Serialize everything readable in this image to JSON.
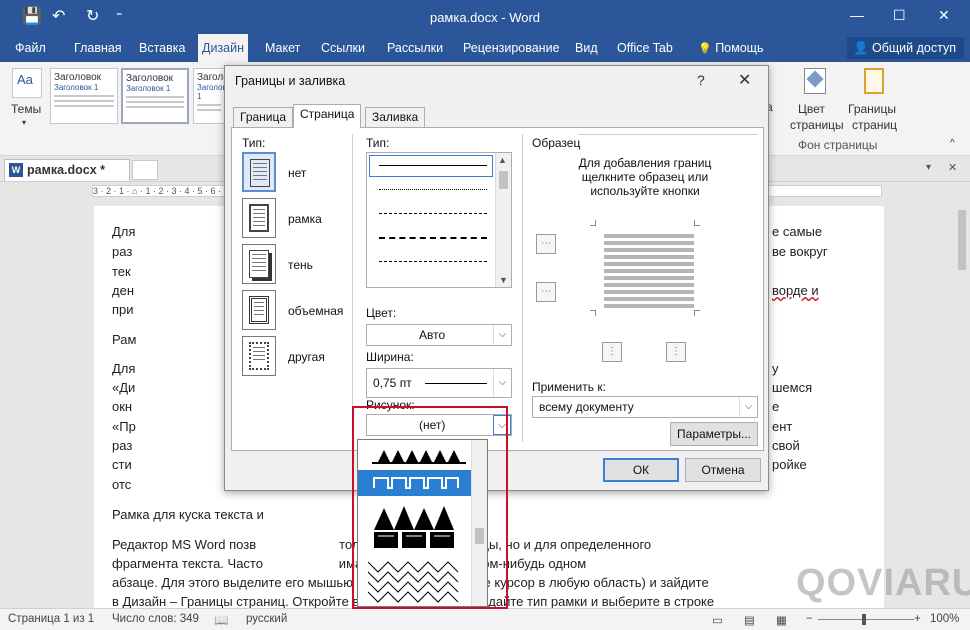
{
  "window": {
    "title": "рамка.docx - Word",
    "qat": [
      "💾",
      "↶",
      "↻",
      "⁼"
    ],
    "controls": [
      "—",
      "☐",
      "✕"
    ]
  },
  "ribbon_tabs": [
    {
      "label": "Файл"
    },
    {
      "label": "Главная"
    },
    {
      "label": "Вставка"
    },
    {
      "label": "Дизайн"
    },
    {
      "label": "Макет"
    },
    {
      "label": "Ссылки"
    },
    {
      "label": "Рассылки"
    },
    {
      "label": "Рецензирование"
    },
    {
      "label": "Вид"
    },
    {
      "label": "Office Tab"
    },
    {
      "label": "Помощь"
    }
  ],
  "share_label": "Общий доступ",
  "ribbon": {
    "themes_label": "Темы",
    "style_gallery": [
      {
        "title": "Заголовок",
        "subtitle": "Заголовок 1"
      },
      {
        "title": "Заголовок",
        "subtitle": "Заголовок 1"
      },
      {
        "title": "Заголовок",
        "subtitle": "Заголовок 1"
      }
    ],
    "page_color_label": [
      "Цвет",
      "страницы"
    ],
    "page_borders_label": [
      "Границы",
      "страниц"
    ],
    "background_group_label": "Фон страницы"
  },
  "doc_tab": {
    "name": "рамка.docx *"
  },
  "ruler_text": "3 · 2 · 1 · ⌂ · 1 · 2 · 3 · 4 · 5 · 6 · 7 · 8 · 9 · 10 · 11 · 12 · 13 · 14 · 15 · 16 · 17 · ",
  "document": {
    "left_stubs": [
      "Для",
      "раз",
      "тек",
      "ден",
      "при",
      "Рам",
      "Для",
      "«Ди",
      "окн",
      "«Пр",
      "раз",
      "сти",
      "отс"
    ],
    "right_fragments": [
      "е самые",
      "ве вокруг",
      "ворде и",
      "у",
      "шемся",
      "е",
      "ент",
      "свой",
      "ройке"
    ],
    "paragraph_frame_line": "Рамка для куска текста и",
    "body_lines": [
      "Редактор MS Word позв                       только для всей страницы, но и для определенного",
      "фрагмента текста. Часто                     имание читателя на каком-нибудь одном",
      "абзаце. Для этого выделите его мышью (или просто поставьте курсор в любую область) и зайдите",
      "в Дизайн – Границы страниц. Откройте вкладку «Граница», задайте тип рамки и выберите в строке"
    ]
  },
  "status_bar": {
    "page": "Страница 1 из 1",
    "words": "Число слов: 349",
    "language": "русский",
    "zoom": "100%"
  },
  "watermark": "QOVIARUM",
  "dialog": {
    "title": "Границы и заливка",
    "help": "?",
    "close": "✕",
    "tabs": [
      {
        "label": "Граница"
      },
      {
        "label": "Страница"
      },
      {
        "label": "Заливка"
      }
    ],
    "active_tab": "Страница",
    "settings_label": "Тип:",
    "settings": [
      {
        "label": "нет",
        "selected": true
      },
      {
        "label": "рамка",
        "selected": false
      },
      {
        "label": "тень",
        "selected": false
      },
      {
        "label": "объемная",
        "selected": false
      },
      {
        "label": "другая",
        "selected": false
      }
    ],
    "style_label": "Тип:",
    "color_label": "Цвет:",
    "color_value": "Авто",
    "width_label": "Ширина:",
    "width_value": "0,75 пт",
    "art_label": "Рисунок:",
    "art_value": "(нет)",
    "preview_label": "Образец",
    "preview_hint": [
      "Для добавления границ",
      "щелкните образец или",
      "используйте кнопки"
    ],
    "apply_label": "Применить к:",
    "apply_value": "всему документу",
    "options_button": "Параметры...",
    "ok_button": "ОК",
    "cancel_button": "Отмена"
  },
  "colors": {
    "accent": "#2b579a",
    "dropdown_selection": "#2a7fd4",
    "highlight_box": "#c8102e"
  }
}
